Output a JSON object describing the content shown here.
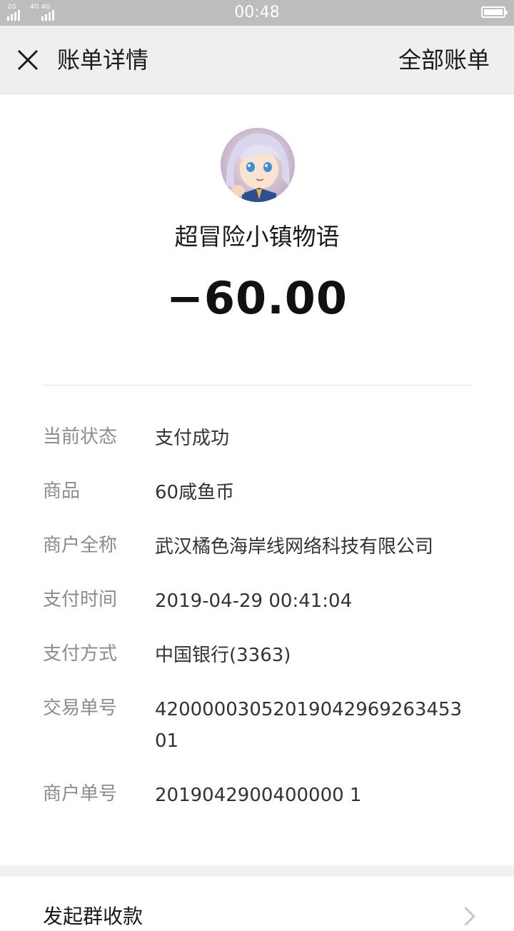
{
  "status_bar": {
    "time": "00:48",
    "network_1": "2G",
    "network_2": "4G",
    "network_3": "4G"
  },
  "header": {
    "title": "账单详情",
    "all_bills": "全部账单"
  },
  "summary": {
    "avatar_icon": "merchant-avatar-anime-girl",
    "merchant_name": "超冒险小镇物语",
    "amount": "−60.00"
  },
  "details": [
    {
      "label": "当前状态",
      "value": "支付成功"
    },
    {
      "label": "商品",
      "value": "60咸鱼币"
    },
    {
      "label": "商户全称",
      "value": "武汉橘色海岸线网络科技有限公司"
    },
    {
      "label": "支付时间",
      "value": "2019-04-29 00:41:04"
    },
    {
      "label": "支付方式",
      "value": "中国银行(3363)"
    },
    {
      "label": "交易单号",
      "value": "42000003052019042969263453 01"
    },
    {
      "label": "商户单号",
      "value": "2019042900400000 1"
    }
  ],
  "footer": {
    "group_collect": "发起群收款"
  },
  "colors": {
    "status_bar_bg": "#bdbdbd",
    "title_bar_bg": "#efefef",
    "label_gray": "#8c8c8c",
    "value_dark": "#333333"
  }
}
